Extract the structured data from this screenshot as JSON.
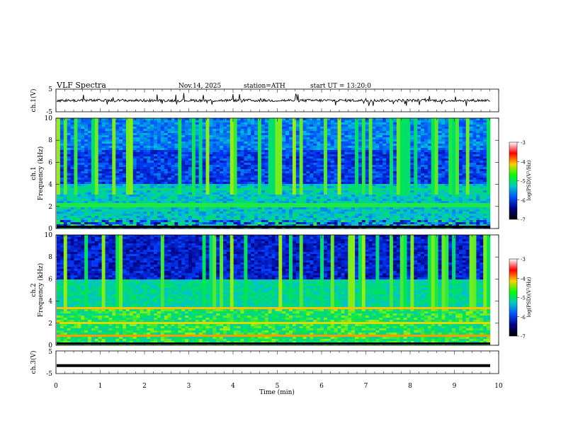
{
  "header": {
    "title": "VLF Spectra",
    "date": "Nov.14, 2025",
    "station": "station=ATH",
    "start": "start UT =  13:20:0"
  },
  "colorbar": {
    "label": "log(PSD)(V²/Hz)",
    "ticks": [
      "-3",
      "-4",
      "-5",
      "-6",
      "-7"
    ],
    "colors": [
      "#ffffff",
      "#ff0000",
      "#ffd000",
      "#00ff00",
      "#00c8c8",
      "#0050ff",
      "#000080",
      "#000000"
    ]
  },
  "chart_data": [
    {
      "type": "line",
      "id": "ch1",
      "ylabel": "ch.1(V)",
      "ylim": [
        -5,
        5
      ],
      "yticks": [
        "5",
        "-5"
      ],
      "xlim": [
        0,
        9.8
      ],
      "baseline": 0
    },
    {
      "type": "heatmap",
      "id": "spec1",
      "ylabel": "ch.1",
      "ylabel2": "Frequency (kHz)",
      "ylim": [
        0,
        10
      ],
      "yticks": [
        "10",
        "8",
        "6",
        "4",
        "2",
        "0"
      ],
      "xlim": [
        0,
        9.8
      ]
    },
    {
      "type": "heatmap",
      "id": "spec2",
      "ylabel": "ch.2",
      "ylabel2": "Frequency (kHz)",
      "ylim": [
        0,
        10
      ],
      "yticks": [
        "10",
        "8",
        "6",
        "4",
        "2",
        "0"
      ],
      "xlim": [
        0,
        9.8
      ]
    },
    {
      "type": "line",
      "id": "ch3",
      "ylabel": "ch.3(V)",
      "ylim": [
        -5,
        5
      ],
      "yticks": [
        "5",
        "-5"
      ],
      "xlim": [
        0,
        9.8
      ],
      "baseline": -1.5
    }
  ],
  "xaxis": {
    "label": "Time (min)",
    "ticks": [
      "0",
      "1",
      "2",
      "3",
      "4",
      "5",
      "6",
      "7",
      "8",
      "9",
      "10"
    ],
    "range": [
      0,
      10
    ]
  }
}
